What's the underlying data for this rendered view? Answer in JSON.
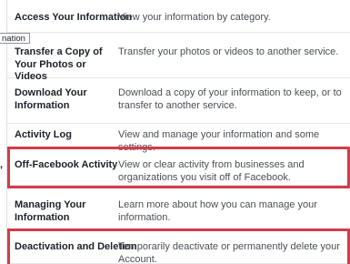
{
  "tooltip_text": "nation",
  "left_mark": ",",
  "highlight_color": "#d43b4c",
  "rows": [
    {
      "title": "Access Your Information",
      "description": "View your information by category."
    },
    {
      "title": "Transfer a Copy of Your Photos or Videos",
      "description": "Transfer your photos or videos to another service."
    },
    {
      "title": "Download Your Information",
      "description": "Download a copy of your information to keep, or to transfer to another service."
    },
    {
      "title": "Activity Log",
      "description": "View and manage your information and some settings."
    },
    {
      "title": "Off-Facebook Activity",
      "description": "View or clear activity from businesses and organizations you visit off of Facebook."
    },
    {
      "title": "Managing Your Information",
      "description": "Learn more about how you can manage your information."
    },
    {
      "title": "Deactivation and Deletion",
      "description": "Temporarily deactivate or permanently delete your Account."
    }
  ]
}
